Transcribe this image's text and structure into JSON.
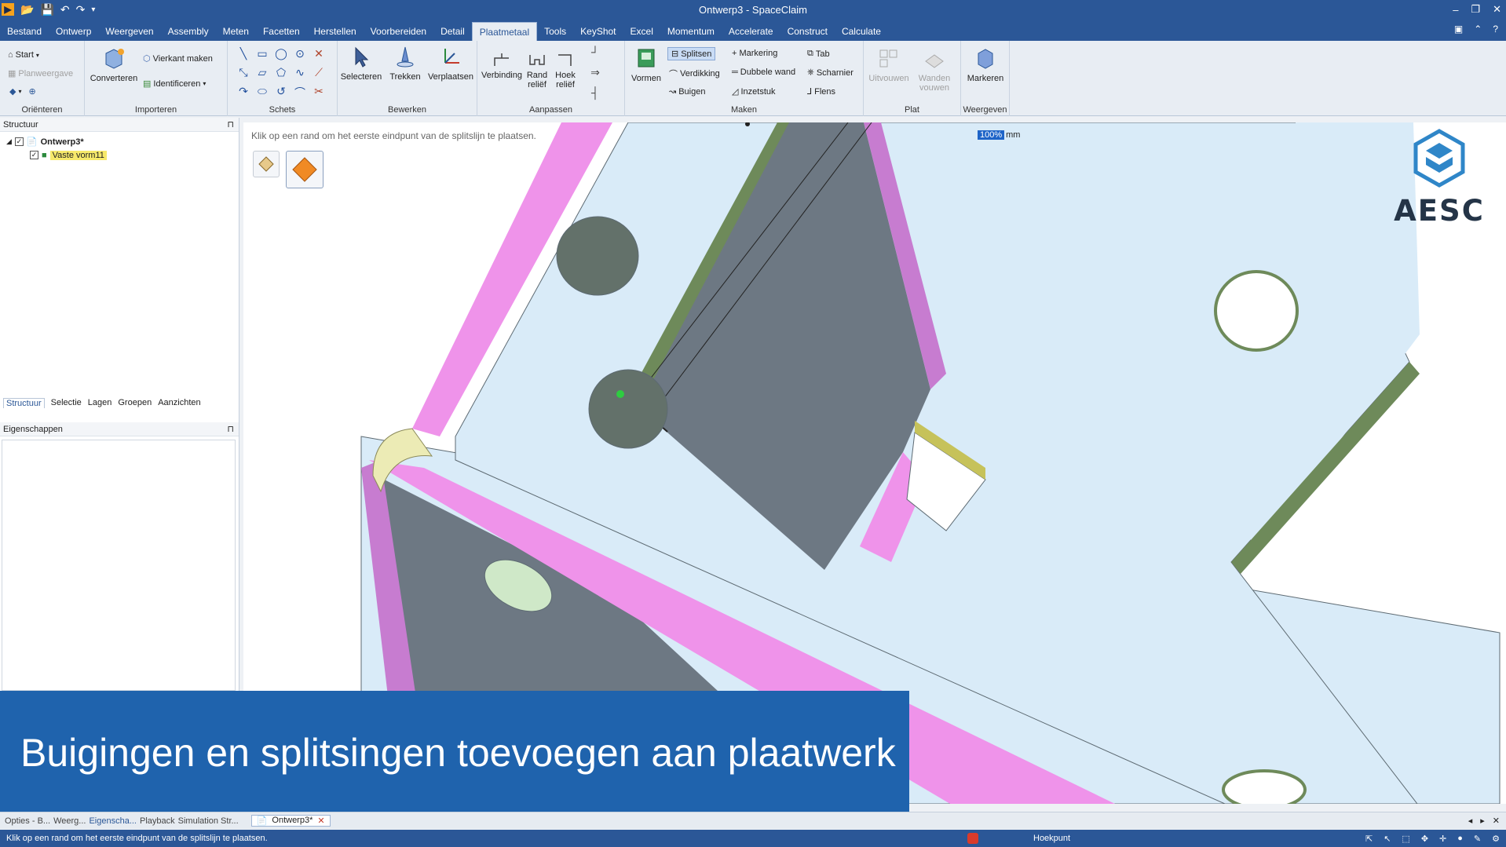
{
  "window": {
    "title": "Ontwerp3 - SpaceClaim",
    "controls": [
      "–",
      "❐",
      "✕"
    ]
  },
  "quick_access": {
    "icons": [
      "app-logo-icon",
      "open-icon",
      "save-icon",
      "undo-icon",
      "redo-icon",
      "customize-icon"
    ]
  },
  "menu": {
    "tabs": [
      "Bestand",
      "Ontwerp",
      "Weergeven",
      "Assembly",
      "Meten",
      "Facetten",
      "Herstellen",
      "Voorbereiden",
      "Detail",
      "Plaatmetaal",
      "Tools",
      "KeyShot",
      "Excel",
      "Momentum",
      "Accelerate",
      "Construct",
      "Calculate"
    ],
    "active": "Plaatmetaal"
  },
  "ribbon": {
    "orienteren": {
      "label": "Oriënteren",
      "start": "Start",
      "planweergave": "Planweergave"
    },
    "importeren": {
      "label": "Importeren",
      "converteren": "Converteren",
      "vierkant_maken": "Vierkant maken",
      "identificeren": "Identificeren"
    },
    "schets": {
      "label": "Schets"
    },
    "bewerken": {
      "label": "Bewerken",
      "selecteren": "Selecteren",
      "trekken": "Trekken",
      "verplaatsen": "Verplaatsen"
    },
    "aanpassen": {
      "label": "Aanpassen",
      "verbinding": "Verbinding",
      "rand_relief": "Rand\nreliëf",
      "hoek_relief": "Hoek\nreliëf"
    },
    "maken": {
      "label": "Maken",
      "vormen": "Vormen",
      "splitsen": "Splitsen",
      "verdikking": "Verdikking",
      "buigen": "Buigen",
      "markering": "Markering",
      "dubbele_wand": "Dubbele wand",
      "inzetstuk": "Inzetstuk",
      "tab": "Tab",
      "scharnier": "Scharnier",
      "flens": "Flens"
    },
    "plat": {
      "label": "Plat",
      "uitvouwen": "Uitvouwen",
      "wanden_vouwen": "Wanden\nvouwen"
    },
    "weergeven": {
      "label": "Weergeven",
      "markeren": "Markeren"
    }
  },
  "structure_panel": {
    "title": "Structuur",
    "root": "Ontwerp3*",
    "child": "Vaste vorm11",
    "tabs": [
      "Structuur",
      "Selectie",
      "Lagen",
      "Groepen",
      "Aanzichten"
    ],
    "active_tab": "Structuur"
  },
  "properties_panel": {
    "title": "Eigenschappen"
  },
  "viewport": {
    "hint": "Klik op een rand om het eerste eindpunt van de splitslijn te plaatsen.",
    "dimension_value": "100%",
    "dimension_unit": "mm",
    "logo_text": "AESC"
  },
  "banner": {
    "text": "Buigingen en splitsingen toevoegen aan plaatwerk"
  },
  "doc_tabs": {
    "left": [
      "Opties - B...",
      "Weerg...",
      "Eigenscha...",
      "Playback",
      "Simulation Str..."
    ],
    "document": "Ontwerp3*"
  },
  "status": {
    "message": "Klik op een rand om het eerste eindpunt van de splitslijn te plaatsen.",
    "mode": "Hoekpunt"
  },
  "colors": {
    "titlebar": "#2b5797",
    "ribbon": "#e8edf3",
    "sheet_face": "#d9ebf8",
    "bend_pink": "#ef93ea",
    "dark_face": "#6d7883",
    "edge_green": "#6e8a5a",
    "banner": "#1f63ad"
  }
}
